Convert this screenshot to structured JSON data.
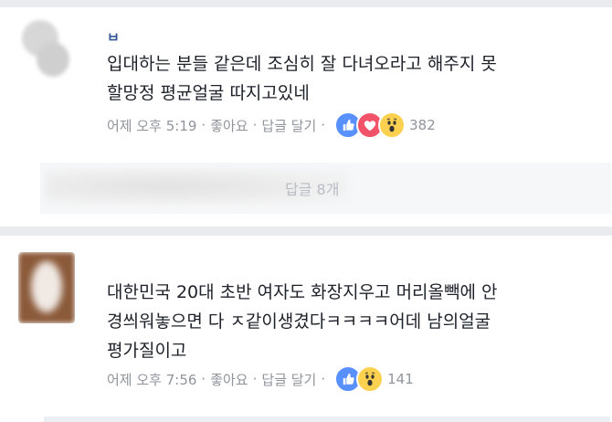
{
  "comments": [
    {
      "author": "ㅂ",
      "lines": [
        "입대하는 분들 같은데 조심히 잘 다녀오라고 해주지 못",
        "할망정 평균얼굴 따지고있네"
      ],
      "time": "어제 오후 5:19",
      "like_label": "좋아요",
      "reply_label": "답글 달기",
      "reaction_icons": [
        "like-icon",
        "love-icon",
        "wow-icon"
      ],
      "reaction_count": "382",
      "replies_label": "답글 8개"
    },
    {
      "author": "",
      "lines": [
        "대한민국 20대 초반 여자도 화장지우고 머리올빽에 안",
        "경씌워놓으면 다 ㅈ같이생겼다ㅋㅋㅋㅋ어데 남의얼굴",
        "평가질이고"
      ],
      "time": "어제 오후 7:56",
      "like_label": "좋아요",
      "reply_label": "답글 달기",
      "reaction_icons": [
        "like-icon",
        "wow-icon"
      ],
      "reaction_count": "141"
    }
  ],
  "colors": {
    "like": "#5890ff",
    "love": "#f25268",
    "wow": "#fcd14f",
    "link": "#365899",
    "meta": "#90949c",
    "divider": "#e9ebee"
  }
}
